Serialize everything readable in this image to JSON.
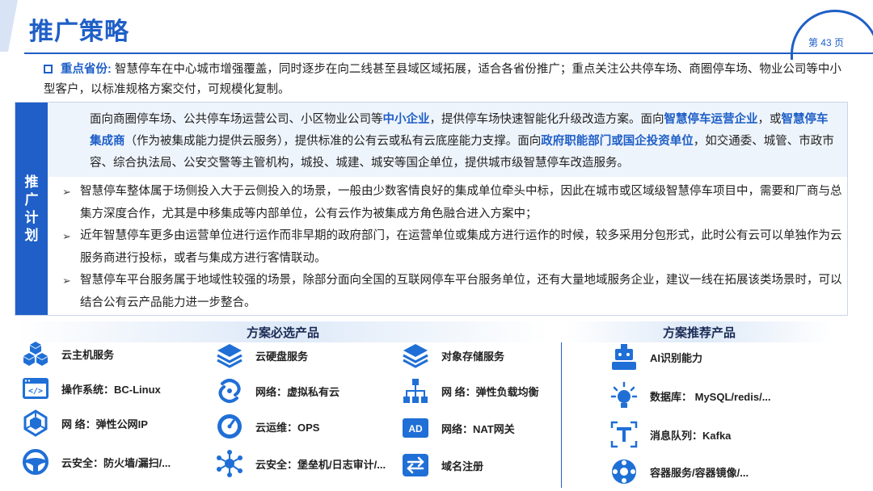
{
  "header": {
    "title": "推广策略",
    "page": "第 43 页"
  },
  "focus": {
    "label": "重点省份:",
    "text": "智慧停车在中心城市增强覆盖，同时逐步在向二线甚至县域区域拓展，适合各省份推广；重点关注公共停车场、商圈停车场、物业公司等中小型客户，以标准规格方案交付，可规模化复制。"
  },
  "plan": {
    "side_label": "推广计划",
    "intro": [
      "面向商圈停车场、公共停车场运营公司、小区物业公司等",
      "中小企业",
      "，提供停车场快速智能化升级改造方案。面向",
      "智慧停车运营企业",
      "，或",
      "智慧停车集成商",
      "（作为被集成能力提供云服务），提供标准的公有云或私有云底座能力支撑。面向",
      "政府职能部门或国企投资单位",
      "，如交通委、城管、市政市容、综合执法局、公安交警等主管机构，城投、城建、城安等国企单位，提供城市级智慧停车改造服务。"
    ],
    "bullets": [
      "智慧停车整体属于场侧投入大于云侧投入的场景，一般由少数客情良好的集成单位牵头中标，因此在城市或区域级智慧停车项目中，需要和厂商与总集方深度合作，尤其是中移集成等内部单位，公有云作为被集成方角色融合进入方案中；",
      "近年智慧停车更多由运营单位进行运作而非早期的政府部门，在运营单位或集成方进行运作的时候，较多采用分包形式，此时公有云可以单独作为云服务商进行投标，或者与集成方进行客情联动。",
      "智慧停车平台服务属于地域性较强的场景，除部分面向全国的互联网停车平台服务单位，还有大量地域服务企业，建议一线在拓展该类场景时，可以结合公有云产品能力进一步整合。"
    ]
  },
  "required": {
    "title": "方案必选产品",
    "items": [
      {
        "icon": "cubes-icon",
        "label": "云主机服务"
      },
      {
        "icon": "code-window-icon",
        "label": "操作系统：BC-Linux"
      },
      {
        "icon": "network-sphere-icon",
        "label": "网  络：弹性公网IP"
      },
      {
        "icon": "steering-wheel-icon",
        "label": "云安全：防火墙/漏扫/..."
      },
      {
        "icon": "layers-icon",
        "label": "云硬盘服务"
      },
      {
        "icon": "swirl-icon",
        "label": "网络：虚拟私有云"
      },
      {
        "icon": "gauge-icon",
        "label": "云运维：OPS"
      },
      {
        "icon": "hub-icon",
        "label": "云安全：堡垒机/日志审计/..."
      },
      {
        "icon": "stack-icon",
        "label": "对象存储服务"
      },
      {
        "icon": "org-tree-icon",
        "label": "网  络：弹性负载均衡"
      },
      {
        "icon": "ad-badge-icon",
        "label": "网络：NAT网关"
      },
      {
        "icon": "swap-arrows-icon",
        "label": "域名注册"
      }
    ]
  },
  "recommended": {
    "title": "方案推荐产品",
    "items": [
      {
        "icon": "ai-robot-icon",
        "label": "AI识别能力"
      },
      {
        "icon": "lightbulb-icon",
        "label": "数据库：  MySQL/redis/..."
      },
      {
        "icon": "text-t-icon",
        "label": "消息队列：Kafka"
      },
      {
        "icon": "container-icon",
        "label": "容器服务/容器镜像/..."
      }
    ]
  },
  "colors": {
    "accent": "#1f5fc7",
    "panel": "#eef4fb"
  }
}
